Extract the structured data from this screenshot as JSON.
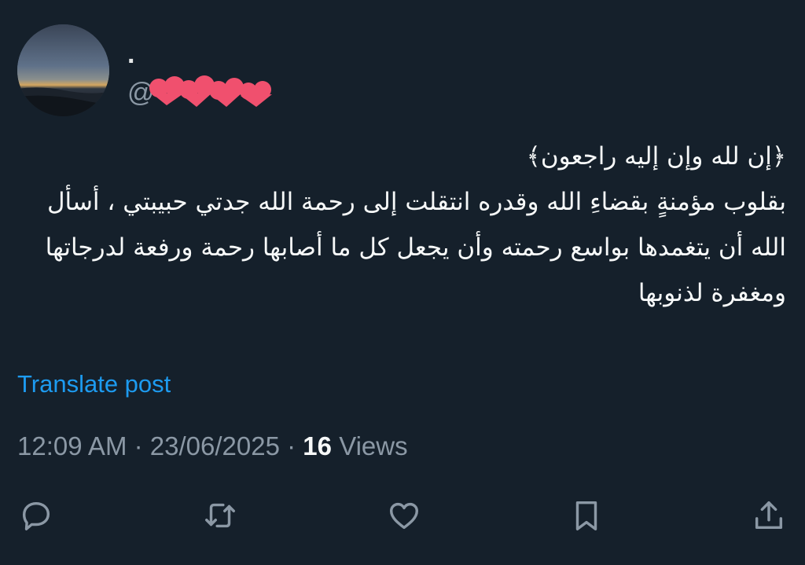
{
  "author": {
    "display_name": ".",
    "handle_prefix": "@"
  },
  "tweet": {
    "text_line1": "﴿إن لله وإن إليه راجعون﴾",
    "text_body": "بقلوب مؤمنةٍ بقضاءِ الله وقدره انتقلت إلى رحمة الله جدتي حبيبتي ، أسأل الله أن يتغمدها بواسع رحمته وأن يجعل كل ما أصابها رحمة ورفعة لدرجاتها ومغفرة لذنوبها"
  },
  "translate_label": "Translate post",
  "meta": {
    "time": "12:09 AM",
    "separator": "·",
    "date": "23/06/2025",
    "views_count": "16",
    "views_label": "Views"
  },
  "actions": {
    "reply_icon": "reply-icon",
    "retweet_icon": "retweet-icon",
    "like_icon": "heart-icon",
    "bookmark_icon": "bookmark-icon",
    "share_icon": "share-icon"
  },
  "colors": {
    "background": "#15202b",
    "text_primary": "#f7f9f9",
    "text_secondary": "#8b98a5",
    "link": "#1d9bf0",
    "redaction": "#f0506e"
  }
}
